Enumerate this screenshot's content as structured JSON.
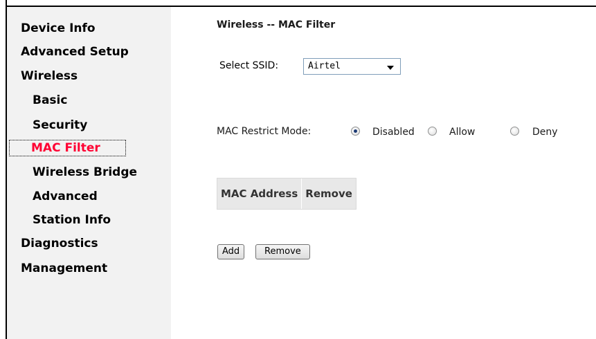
{
  "sidebar": {
    "items": [
      {
        "label": "Device Info"
      },
      {
        "label": "Advanced Setup"
      },
      {
        "label": "Wireless"
      },
      {
        "label": "Basic"
      },
      {
        "label": "Security"
      },
      {
        "label": "MAC Filter"
      },
      {
        "label": "Wireless Bridge"
      },
      {
        "label": "Advanced"
      },
      {
        "label": "Station Info"
      },
      {
        "label": "Diagnostics"
      },
      {
        "label": "Management"
      }
    ],
    "active_color": "#ff0033"
  },
  "main": {
    "title": "Wireless -- MAC Filter",
    "ssid_label": "Select SSID:",
    "ssid_value": "Airtel",
    "mode_label": "MAC Restrict Mode:",
    "mode_options": [
      "Disabled",
      "Allow",
      "Deny"
    ],
    "mode_selected": "Disabled",
    "table_headers": [
      "MAC Address",
      "Remove"
    ],
    "add_button": "Add",
    "remove_button": "Remove"
  }
}
